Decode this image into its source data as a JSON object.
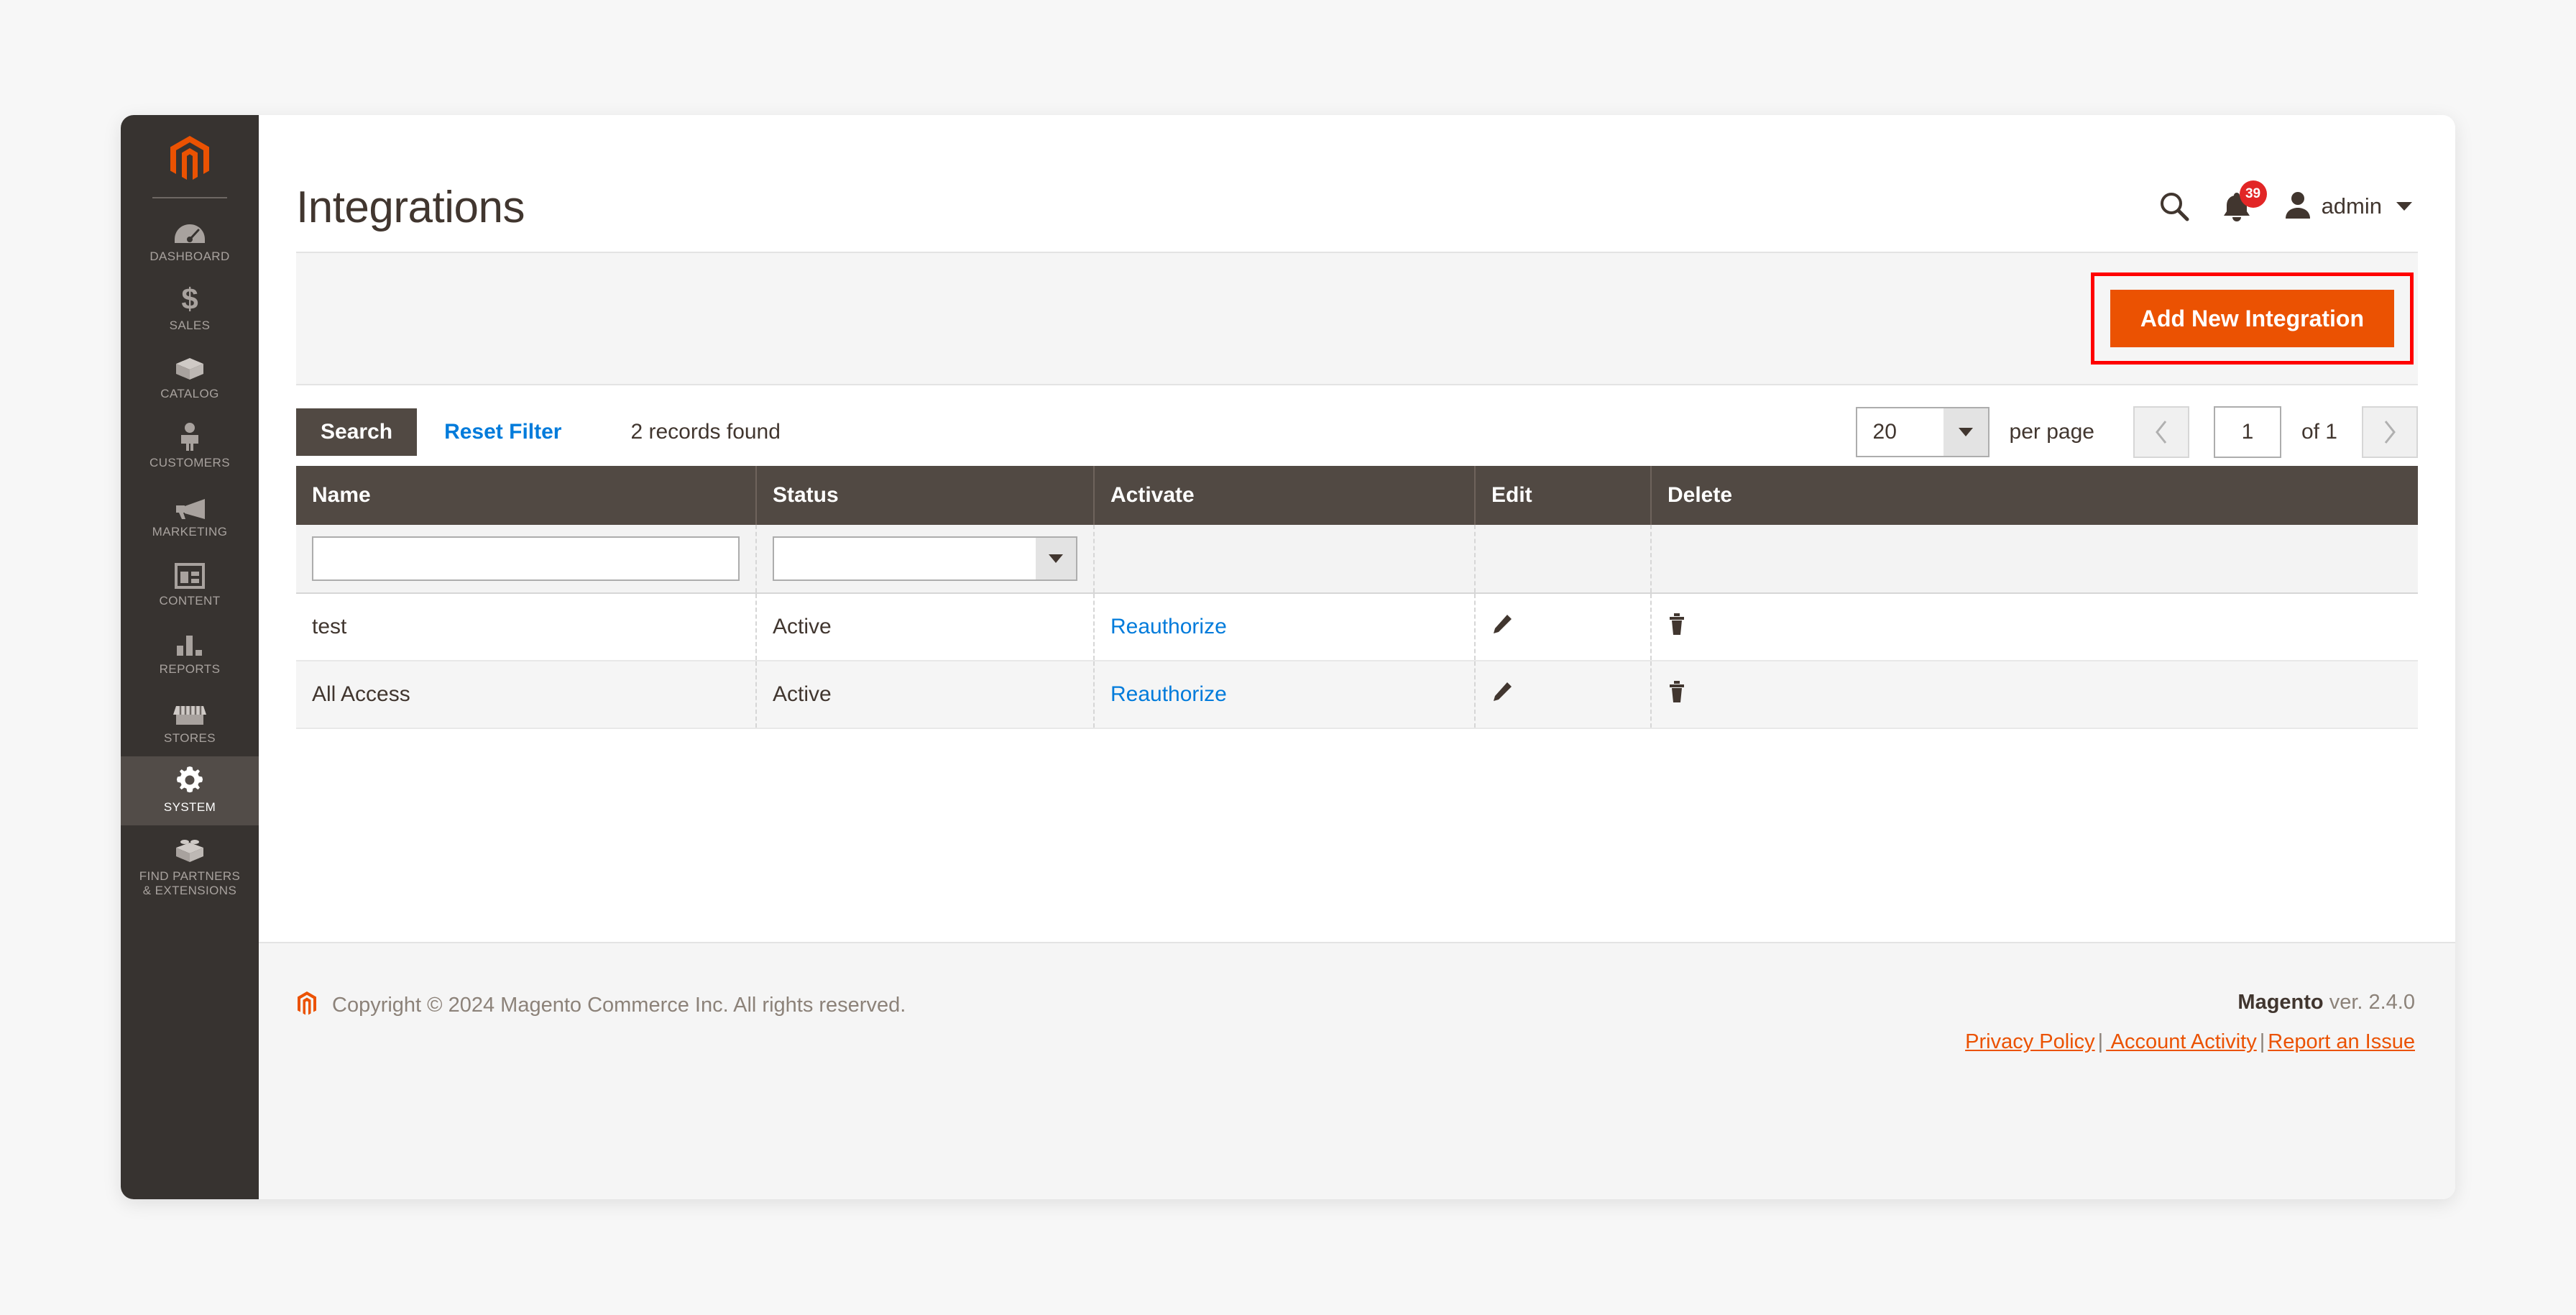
{
  "sidebar": {
    "logo_icon": "magento-logo-icon",
    "items": [
      {
        "label": "Dashboard",
        "icon": "dashboard-gauge-icon",
        "id": "dashboard",
        "active": false
      },
      {
        "label": "Sales",
        "icon": "dollar-sign-icon",
        "id": "sales",
        "active": false
      },
      {
        "label": "Catalog",
        "icon": "box-icon",
        "id": "catalog",
        "active": false
      },
      {
        "label": "Customers",
        "icon": "person-icon",
        "id": "customers",
        "active": false
      },
      {
        "label": "Marketing",
        "icon": "megaphone-icon",
        "id": "marketing",
        "active": false
      },
      {
        "label": "Content",
        "icon": "layout-window-icon",
        "id": "content",
        "active": false
      },
      {
        "label": "Reports",
        "icon": "bar-chart-icon",
        "id": "reports",
        "active": false
      },
      {
        "label": "Stores",
        "icon": "storefront-icon",
        "id": "stores",
        "active": false
      },
      {
        "label": "System",
        "icon": "gear-icon",
        "id": "system",
        "active": true
      },
      {
        "label": "Find Partners\n& Extensions",
        "icon": "lego-brick-icon",
        "id": "find-partners",
        "active": false
      }
    ]
  },
  "header": {
    "title": "Integrations",
    "search_icon": "search-icon",
    "notifications_icon": "bell-icon",
    "notifications_count": "39",
    "avatar_icon": "user-avatar-icon",
    "user_name": "admin",
    "caret_icon": "chevron-down-icon"
  },
  "page_actions": {
    "add_new_integration_label": "Add New Integration",
    "highlight_color": "#ff0000",
    "button_color": "#eb5202"
  },
  "toolbar": {
    "search_label": "Search",
    "reset_filter_label": "Reset Filter",
    "records_found": "2 records found",
    "per_page_value": "20",
    "per_page_label": "per page",
    "prev_icon": "chevron-left-icon",
    "next_icon": "chevron-right-icon",
    "page_value": "1",
    "page_total": "of 1"
  },
  "grid": {
    "columns": [
      "Name",
      "Status",
      "Activate",
      "Edit",
      "Delete"
    ],
    "filters": {
      "name_value": "",
      "name_placeholder": "",
      "status_value": ""
    },
    "rows": [
      {
        "name": "test",
        "status": "Active",
        "activate": "Reauthorize",
        "edit_icon": "pencil-icon",
        "delete_icon": "trash-icon"
      },
      {
        "name": "All Access",
        "status": "Active",
        "activate": "Reauthorize",
        "edit_icon": "pencil-icon",
        "delete_icon": "trash-icon"
      }
    ]
  },
  "footer": {
    "logo_icon": "magento-logo-icon",
    "copyright": "Copyright © 2024 Magento Commerce Inc. All rights reserved.",
    "version_brand": "Magento",
    "version_text": " ver. 2.4.0",
    "links": [
      {
        "label": "Privacy Policy"
      },
      {
        "label": " Account Activity"
      },
      {
        "label": "Report an Issue"
      }
    ],
    "separator": "|"
  }
}
